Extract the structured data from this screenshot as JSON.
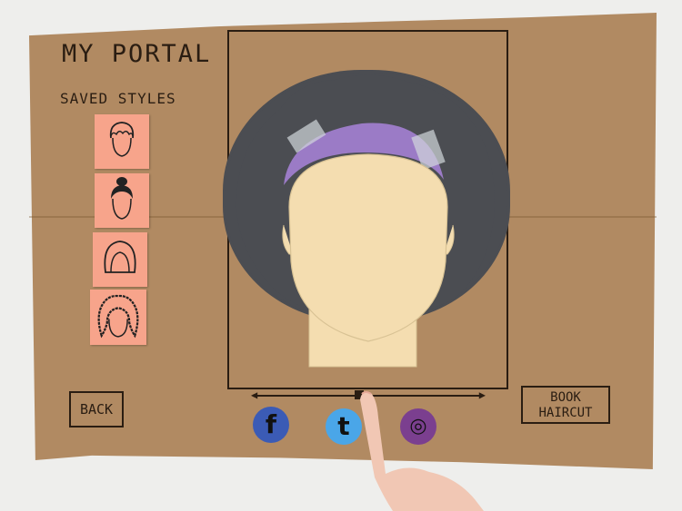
{
  "header": {
    "title": "MY PORTAL"
  },
  "saved_styles": {
    "label": "SAVED STYLES",
    "items": [
      {
        "style": "short-curly"
      },
      {
        "style": "bun-updo"
      },
      {
        "style": "bob"
      },
      {
        "style": "long-curly"
      }
    ]
  },
  "preview": {
    "hair": "afro",
    "accessory": "headband",
    "colors": {
      "hair": "#4b4d52",
      "headband": "#9b7bc6",
      "face": "#f4ddb0",
      "sticky_note": "#f7a48b",
      "paper": "#b18a62"
    }
  },
  "navigation": {
    "back_label": "BACK",
    "book_label_line1": "BOOK",
    "book_label_line2": "HAIRCUT"
  },
  "slider": {
    "position": 0.46
  },
  "share": {
    "facebook": {
      "glyph": "f",
      "color": "#3b5bb5"
    },
    "twitter": {
      "glyph": "t",
      "color": "#4aa6e8"
    },
    "instagram": {
      "glyph": "◎",
      "color": "#7b3f8f"
    }
  }
}
